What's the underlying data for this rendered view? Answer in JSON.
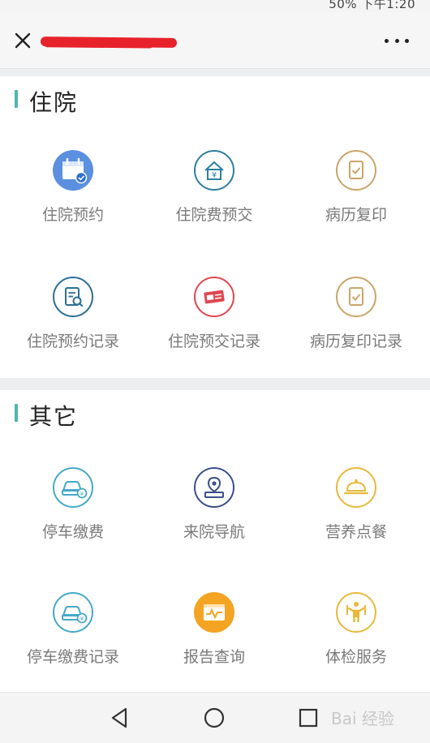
{
  "status_bar": {
    "text": "50%  下午1:20"
  },
  "header": {
    "close_label": "×",
    "more_label": "..."
  },
  "sections": [
    {
      "title": "住院",
      "items": [
        {
          "label": "住院预约",
          "icon": "calendar-check-icon",
          "color": "#4a90e2"
        },
        {
          "label": "住院费预交",
          "icon": "yuan-home-icon",
          "color": "#2d7f9e"
        },
        {
          "label": "病历复印",
          "icon": "document-check-icon",
          "color": "#c9a56a"
        },
        {
          "label": "住院预约记录",
          "icon": "document-search-icon",
          "color": "#2b6f95"
        },
        {
          "label": "住院预交记录",
          "icon": "money-note-icon",
          "color": "#e0474f"
        },
        {
          "label": "病历复印记录",
          "icon": "document-check-icon",
          "color": "#c9a56a"
        }
      ]
    },
    {
      "title": "其它",
      "items": [
        {
          "label": "停车缴费",
          "icon": "car-yuan-icon",
          "color": "#45a9c9"
        },
        {
          "label": "来院导航",
          "icon": "location-pin-icon",
          "color": "#3c4f8c"
        },
        {
          "label": "营养点餐",
          "icon": "food-cloche-icon",
          "color": "#e8b93a"
        },
        {
          "label": "停车缴费记录",
          "icon": "car-yuan-icon",
          "color": "#45a9c9"
        },
        {
          "label": "报告查询",
          "icon": "report-pulse-icon",
          "color": "#f4a423"
        },
        {
          "label": "体检服务",
          "icon": "fitness-person-icon",
          "color": "#e8b93a"
        }
      ]
    }
  ],
  "navigation": {
    "watermark": "Bai 经验"
  }
}
